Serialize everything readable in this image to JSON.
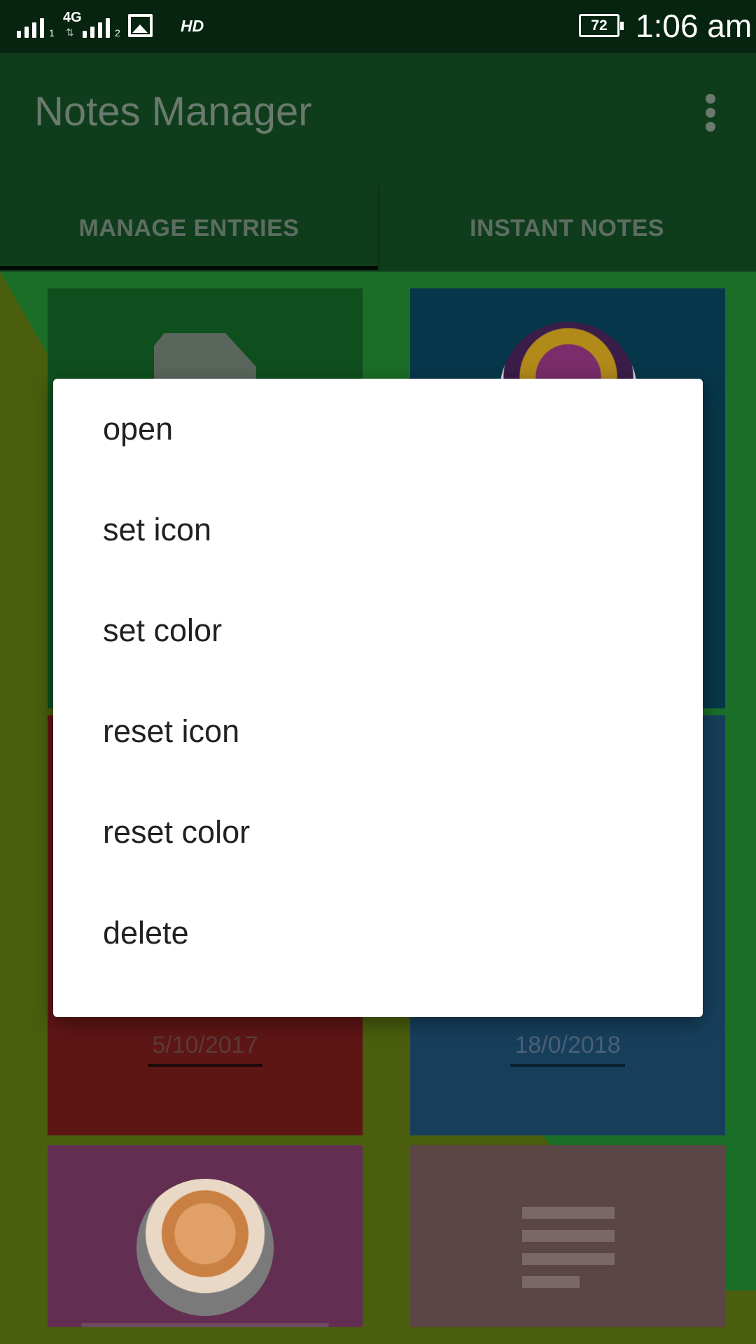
{
  "status_bar": {
    "network": "4G",
    "hd": "HD",
    "battery": "72",
    "time": "1:06 am",
    "sim1": "1",
    "sim2": "2"
  },
  "app_bar": {
    "title": "Notes Manager"
  },
  "tabs": [
    {
      "label": "MANAGE ENTRIES",
      "selected": true
    },
    {
      "label": "INSTANT NOTES",
      "selected": false
    }
  ],
  "entries": [
    {
      "icon": "file-icon",
      "date": ""
    },
    {
      "icon": "mask-image",
      "date": ""
    },
    {
      "icon": "",
      "date": "5/10/2017"
    },
    {
      "icon": "",
      "date": "18/0/2018"
    },
    {
      "icon": "kitten-image",
      "date": ""
    },
    {
      "icon": "text-lines-icon",
      "date": ""
    }
  ],
  "context_menu": {
    "items": [
      "open",
      "set icon",
      "set color",
      "reset icon",
      "reset color",
      "delete"
    ]
  },
  "colors": {
    "status_bar": "#06240f",
    "app_bar": "#0f3d1c",
    "dialog": "#ffffff",
    "menu_text": "#212121"
  }
}
